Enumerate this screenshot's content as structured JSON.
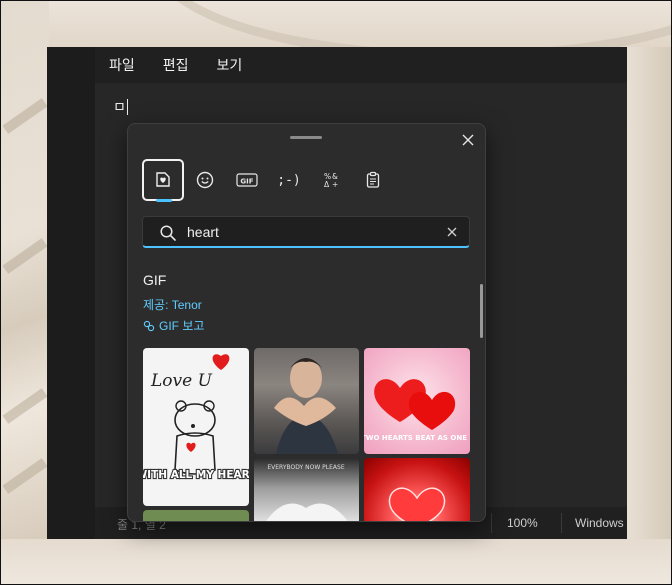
{
  "menu": {
    "file": "파일",
    "edit": "편집",
    "view": "보기"
  },
  "editor": {
    "content": "ㅁ"
  },
  "status": {
    "position": "줄 1, 열 2",
    "zoom": "100%",
    "encoding": "Windows"
  },
  "panel": {
    "tabs": [
      {
        "name": "recent",
        "icon": "heart-sticker-icon"
      },
      {
        "name": "emoji",
        "icon": "smiley-icon"
      },
      {
        "name": "gif",
        "icon": "gif-icon",
        "label": "GIF"
      },
      {
        "name": "kaomoji",
        "icon": "kaomoji-icon",
        "label": ";-)"
      },
      {
        "name": "symbols",
        "icon": "symbols-icon"
      },
      {
        "name": "clipboard",
        "icon": "clipboard-icon"
      }
    ],
    "search": {
      "value": "heart",
      "placeholder": ""
    },
    "section_title": "GIF",
    "provider": "제공: Tenor",
    "view_gif": "GIF 보고",
    "gifs": [
      {
        "caption": "Love U",
        "caption2": "WITH ALL MY HEART"
      },
      {
        "caption": ""
      },
      {
        "caption": "TWO HEARTS BEAT AS ONE"
      },
      {
        "caption": "EVERYBODY NOW PLEASE"
      },
      {
        "caption": ""
      }
    ]
  },
  "colors": {
    "accent": "#4cc2ff",
    "link": "#60cdff",
    "panel_bg": "#2c2c2c",
    "window_bg": "#202020"
  }
}
